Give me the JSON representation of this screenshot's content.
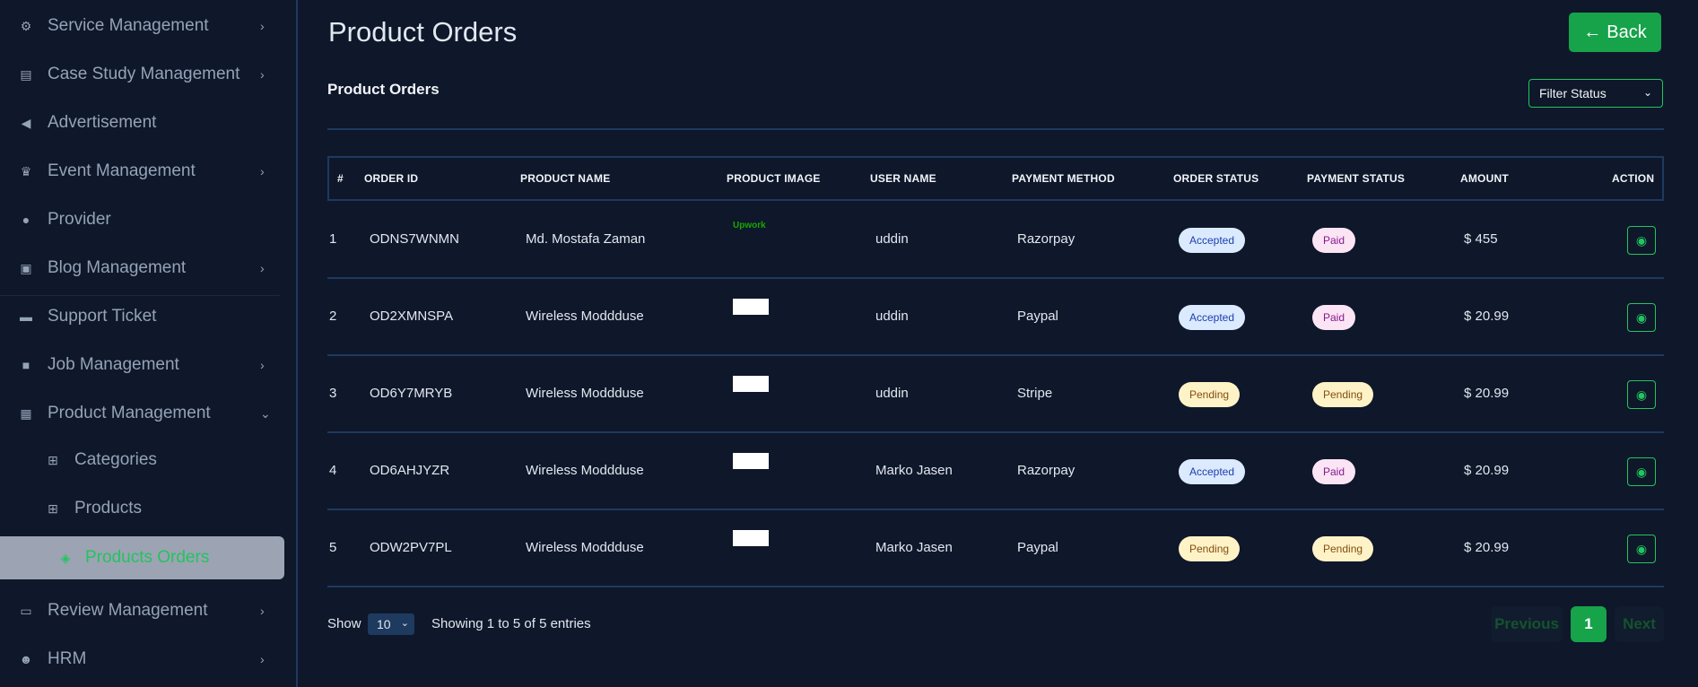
{
  "sidebar": {
    "items": [
      {
        "label": "Service Management",
        "icon": "network-icon",
        "glyph": "⚙",
        "chevron": "›"
      },
      {
        "label": "Case Study Management",
        "icon": "document-icon",
        "glyph": "▤",
        "chevron": "›"
      },
      {
        "label": "Advertisement",
        "icon": "megaphone-icon",
        "glyph": "◀",
        "chevron": ""
      },
      {
        "label": "Event Management",
        "icon": "trophy-icon",
        "glyph": "♛",
        "chevron": "›"
      },
      {
        "label": "Provider",
        "icon": "user-icon",
        "glyph": "●",
        "chevron": ""
      },
      {
        "label": "Blog Management",
        "icon": "blog-icon",
        "glyph": "▣",
        "chevron": "›"
      },
      {
        "label": "Support Ticket",
        "icon": "ticket-icon",
        "glyph": "▬",
        "chevron": ""
      },
      {
        "label": "Job Management",
        "icon": "briefcase-icon",
        "glyph": "■",
        "chevron": "›"
      },
      {
        "label": "Product Management",
        "icon": "grid-icon",
        "glyph": "▦",
        "chevron": "⌄"
      },
      {
        "label": "Categories",
        "icon": "categories-icon",
        "glyph": "⊞",
        "chevron": ""
      },
      {
        "label": "Products",
        "icon": "products-icon",
        "glyph": "⊞",
        "chevron": ""
      },
      {
        "label": "Products Orders",
        "icon": "orders-icon",
        "glyph": "◈",
        "chevron": ""
      },
      {
        "label": "Review Management",
        "icon": "review-icon",
        "glyph": "▭",
        "chevron": "›"
      },
      {
        "label": "HRM",
        "icon": "team-icon",
        "glyph": "☻",
        "chevron": "›"
      }
    ]
  },
  "header": {
    "title": "Product Orders",
    "back_label": "Back",
    "back_glyph": "←"
  },
  "section": {
    "title": "Product Orders",
    "filter_placeholder": "Filter Status",
    "filter_chevron": "⌄"
  },
  "table": {
    "columns": [
      "#",
      "ORDER ID",
      "PRODUCT NAME",
      "PRODUCT IMAGE",
      "USER NAME",
      "PAYMENT METHOD",
      "ORDER STATUS",
      "PAYMENT STATUS",
      "AMOUNT",
      "ACTION"
    ],
    "rows": [
      {
        "num": "1",
        "order_id": "ODNS7WNMN",
        "product": "Md. Mostafa Zaman",
        "image": "Upwork",
        "user": "uddin",
        "method": "Razorpay",
        "order_status": "Accepted",
        "payment_status": "Paid",
        "amount": "$ 455"
      },
      {
        "num": "2",
        "order_id": "OD2XMNSPA",
        "product": "Wireless Moddduse",
        "image": "",
        "user": "uddin",
        "method": "Paypal",
        "order_status": "Accepted",
        "payment_status": "Paid",
        "amount": "$ 20.99"
      },
      {
        "num": "3",
        "order_id": "OD6Y7MRYB",
        "product": "Wireless Moddduse",
        "image": "",
        "user": "uddin",
        "method": "Stripe",
        "order_status": "Pending",
        "payment_status": "Pending",
        "amount": "$ 20.99"
      },
      {
        "num": "4",
        "order_id": "OD6AHJYZR",
        "product": "Wireless Moddduse",
        "image": "",
        "user": "Marko Jasen",
        "method": "Razorpay",
        "order_status": "Accepted",
        "payment_status": "Paid",
        "amount": "$ 20.99"
      },
      {
        "num": "5",
        "order_id": "ODW2PV7PL",
        "product": "Wireless Moddduse",
        "image": "",
        "user": "Marko Jasen",
        "method": "Paypal",
        "order_status": "Pending",
        "payment_status": "Pending",
        "amount": "$ 20.99"
      }
    ],
    "view_glyph": "◉"
  },
  "footer": {
    "show_label": "Show",
    "page_size": "10",
    "page_size_chevron": "⌄",
    "info": "Showing 1 to 5 of 5 entries",
    "prev_label": "Previous",
    "current_page": "1",
    "next_label": "Next"
  },
  "colors": {
    "background": "#0f172a",
    "accent": "#16a34a",
    "border": "#1e3a5f"
  }
}
